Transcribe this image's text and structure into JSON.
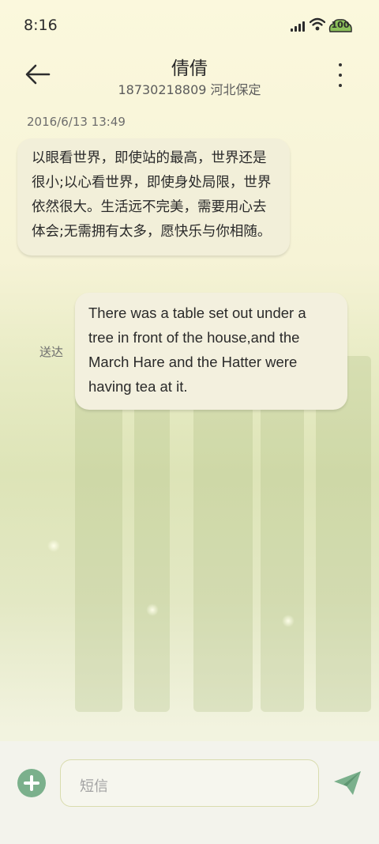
{
  "status_bar": {
    "time": "8:16",
    "battery": "100"
  },
  "header": {
    "contact_name": "倩倩",
    "contact_detail": "18730218809 河北保定"
  },
  "messages": [
    {
      "direction": "incoming",
      "timestamp": "2016/6/13 13:49",
      "text": "以眼看世界，即使站的最高，世界还是很小;以心看世界，即使身处局限，世界依然很大。生活远不完美，需要用心去体会;无需拥有太多，愿快乐与你相随。"
    },
    {
      "direction": "outgoing",
      "status": "送达",
      "text": "There was a table set out under a tree in front of the house,and the March Hare and the Hatter were having tea at it."
    }
  ],
  "composer": {
    "placeholder": "短信"
  },
  "colors": {
    "accent": "#7bb08c",
    "background": "#fbf8dd"
  }
}
